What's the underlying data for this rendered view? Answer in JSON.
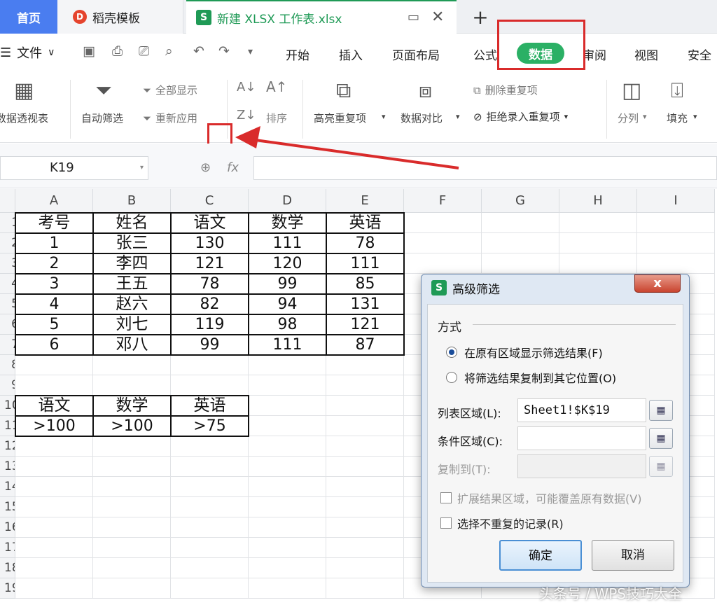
{
  "tabs": {
    "home": "首页",
    "template": "稻壳模板",
    "file": "新建 XLSX 工作表.xlsx",
    "file_icon": "S",
    "template_icon": "D",
    "add": "+"
  },
  "menu": {
    "file": "文件",
    "items": [
      "开始",
      "插入",
      "页面布局",
      "公式",
      "数据",
      "审阅",
      "视图",
      "安全"
    ],
    "active": "数据"
  },
  "ribbon": {
    "pivot": "数据透视表",
    "autofilter": "自动筛选",
    "show_all": "全部显示",
    "reapply": "重新应用",
    "sort": "排序",
    "highlight_dup": "高亮重复项",
    "compare": "数据对比",
    "delete_dup": "删除重复项",
    "reject_dup": "拒绝录入重复项",
    "split": "分列",
    "fill": "填充"
  },
  "formula_bar": {
    "name_box": "K19",
    "fx": "fx"
  },
  "sheet": {
    "columns": [
      "A",
      "B",
      "C",
      "D",
      "E",
      "F",
      "G",
      "H",
      "I"
    ],
    "rows": [
      "1",
      "2",
      "3",
      "4",
      "5",
      "6",
      "7",
      "8",
      "9",
      "10",
      "11",
      "12",
      "13",
      "14",
      "15",
      "16",
      "17",
      "18",
      "19"
    ],
    "table1": {
      "header": [
        "考号",
        "姓名",
        "语文",
        "数学",
        "英语"
      ],
      "rows": [
        [
          "1",
          "张三",
          "130",
          "111",
          "78"
        ],
        [
          "2",
          "李四",
          "121",
          "120",
          "111"
        ],
        [
          "3",
          "王五",
          "78",
          "99",
          "85"
        ],
        [
          "4",
          "赵六",
          "82",
          "94",
          "131"
        ],
        [
          "5",
          "刘七",
          "119",
          "98",
          "121"
        ],
        [
          "6",
          "邓八",
          "99",
          "111",
          "87"
        ]
      ]
    },
    "criteria": {
      "header": [
        "语文",
        "数学",
        "英语"
      ],
      "values": [
        ">100",
        ">100",
        ">75"
      ]
    }
  },
  "dialog": {
    "title": "高级筛选",
    "close": "x",
    "group_label": "方式",
    "option_in_place": "在原有区域显示筛选结果(F)",
    "option_copy": "将筛选结果复制到其它位置(O)",
    "list_range_label": "列表区域(L):",
    "list_range_value": "Sheet1!$K$19",
    "criteria_range_label": "条件区域(C):",
    "criteria_range_value": "",
    "copy_to_label": "复制到(T):",
    "copy_to_value": "",
    "extend_label": "扩展结果区域，可能覆盖原有数据(V)",
    "unique_label": "选择不重复的记录(R)",
    "ok": "确定",
    "cancel": "取消"
  },
  "watermark": "头条号 / WPS技巧大全",
  "colors": {
    "accent_green": "#2bb065",
    "annotation_red": "#d92b2b",
    "home_tab_blue": "#4a7df0"
  }
}
